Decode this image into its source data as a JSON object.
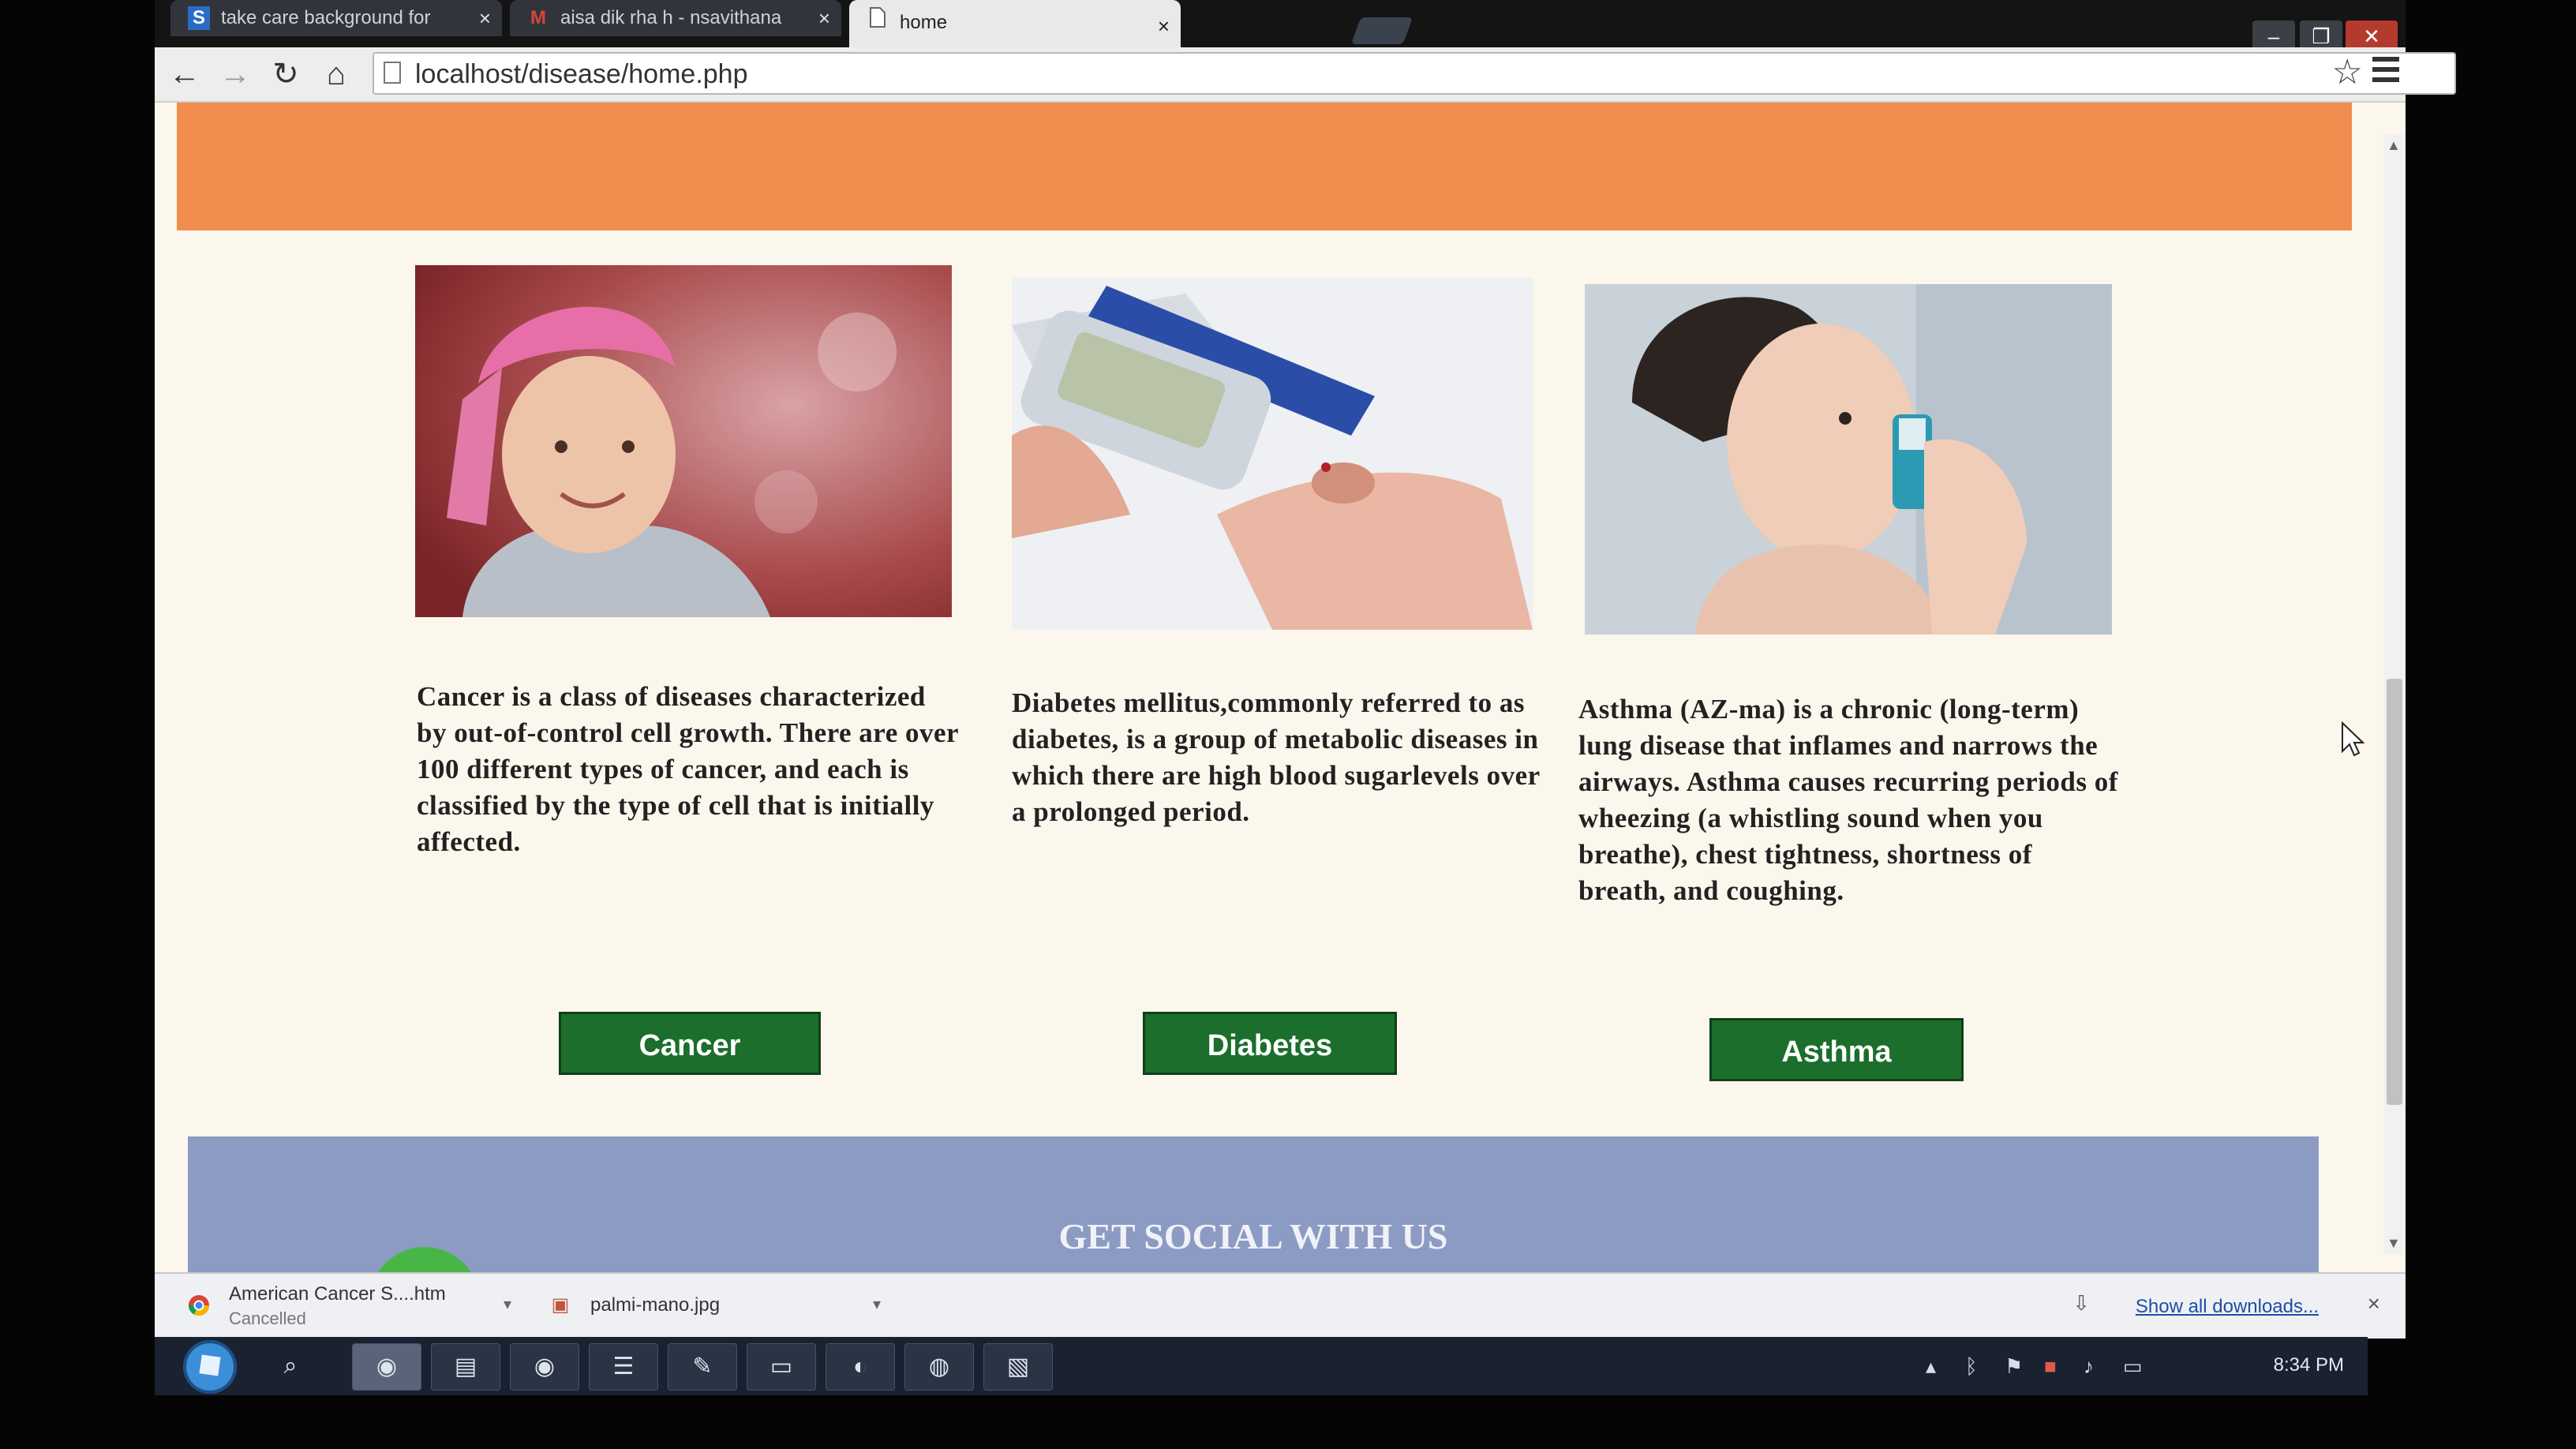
{
  "browser": {
    "tabs": [
      {
        "label": "take care background for",
        "icon": "S"
      },
      {
        "label": "aisa dik rha h - nsavithana",
        "icon": "M"
      },
      {
        "label": "home",
        "icon": "page-icon"
      }
    ],
    "close_glyph": "×",
    "url": "localhost/disease/home.php"
  },
  "page": {
    "cards": [
      {
        "title": "Cancer",
        "description": "Cancer is a class of diseases characterized by out-of-control cell growth. There are over 100 different types of cancer, and each is classified by the type of cell that is initially affected.",
        "button": "Cancer"
      },
      {
        "title": "Diabetes",
        "description": "Diabetes mellitus,commonly referred to as diabetes, is a group of metabolic diseases in which there are high blood sugarlevels over a prolonged period.",
        "button": "Diabetes"
      },
      {
        "title": "Asthma",
        "description": "Asthma (AZ-ma) is a chronic (long-term) lung disease that inflames and narrows the airways. Asthma causes recurring periods of wheezing (a whistling sound when you breathe), chest tightness, shortness of breath, and coughing.",
        "button": "Asthma"
      }
    ],
    "social_title": "GET SOCIAL WITH US",
    "colors": {
      "header_band": "#f08c4e",
      "button_green": "#1b6e2c",
      "social_band": "#8c9bc3",
      "page_bg": "#fbf7ec"
    }
  },
  "downloads": {
    "items": [
      {
        "name": "American Cancer S....htm",
        "status": "Cancelled",
        "icon": "chrome-icon"
      },
      {
        "name": "palmi-mano.jpg",
        "status": "",
        "icon": "image-file-icon"
      }
    ],
    "show_all": "Show all downloads...",
    "close_glyph": "×"
  },
  "taskbar": {
    "clock": "8:34 PM"
  }
}
